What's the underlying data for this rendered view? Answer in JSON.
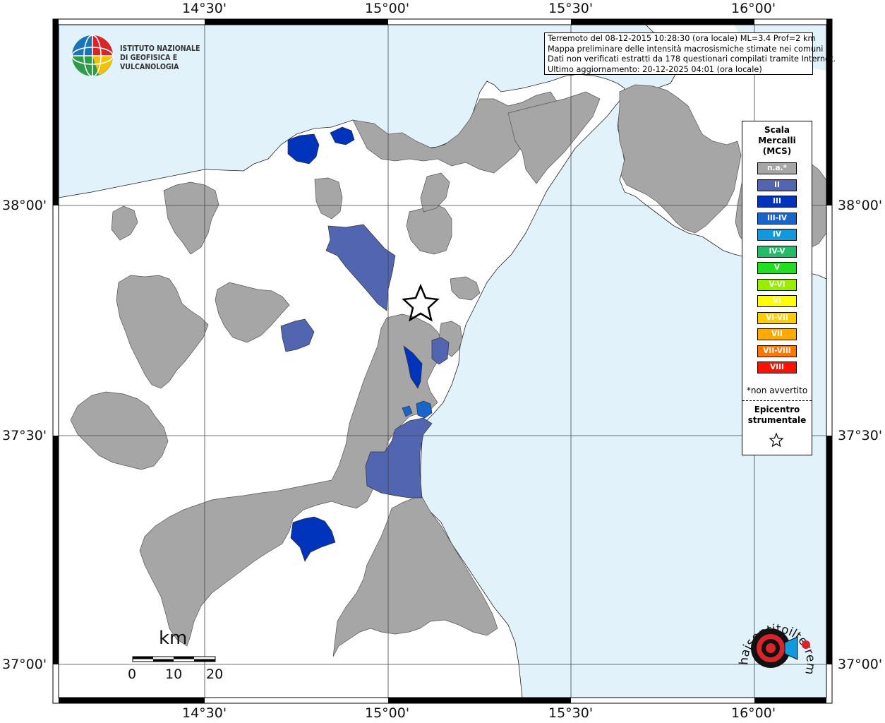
{
  "info": {
    "line1": "Terremoto del 08-12-2015 10:28:30 (ora locale) ML=3.4 Prof=2 km",
    "line2": "Mappa preliminare delle intensità macrosismiche stimate nei comuni",
    "line3": "Dati non verificati estratti da 178 questionari compilati tramite Internet.",
    "line4": "Ultimo aggiornamento: 20-12-2025 04:01 (ora locale)"
  },
  "logo": {
    "line1": "ISTITUTO NAZIONALE",
    "line2": "DI GEOFISICA E VULCANOLOGIA"
  },
  "axes": {
    "top": [
      "14°30'",
      "15°00'",
      "15°30'",
      "16°00'"
    ],
    "bottom": [
      "14°30'",
      "15°00'",
      "15°30'",
      "16°00'"
    ],
    "left": [
      "38°00'",
      "37°30'",
      "37°00'"
    ],
    "right": [
      "38°00'",
      "37°30'",
      "37°00'"
    ]
  },
  "legend": {
    "title1": "Scala",
    "title2": "Mercalli",
    "title3": "(MCS)",
    "items": [
      {
        "label": "n.a.*",
        "color": "#a6a6a6"
      },
      {
        "label": "II",
        "color": "#5165b0"
      },
      {
        "label": "III",
        "color": "#0033bb"
      },
      {
        "label": "III-IV",
        "color": "#1866cc"
      },
      {
        "label": "IV",
        "color": "#1199dd"
      },
      {
        "label": "IV-V",
        "color": "#22bb66"
      },
      {
        "label": "V",
        "color": "#22dd22"
      },
      {
        "label": "V-VI",
        "color": "#99ee00"
      },
      {
        "label": "VI",
        "color": "#ffff00"
      },
      {
        "label": "VI-VII",
        "color": "#ffcc00"
      },
      {
        "label": "VII",
        "color": "#ffaa00"
      },
      {
        "label": "VII-VIII",
        "color": "#ff7700"
      },
      {
        "label": "VIII",
        "color": "#ff1100"
      }
    ],
    "note": "*non avvertito",
    "epicentre1": "Epicentro",
    "epicentre2": "strumentale"
  },
  "scalebar": {
    "unit": "km",
    "ticks": [
      "0",
      "10",
      "20"
    ]
  },
  "colors": {
    "sea": "#e1f2fb",
    "land": "#ffffff",
    "na": "#a6a6a6",
    "ii": "#5165b0",
    "iii": "#0033bb",
    "iii_iv": "#1866cc"
  },
  "site_logo_text": "haisentitoilterremoto.it"
}
